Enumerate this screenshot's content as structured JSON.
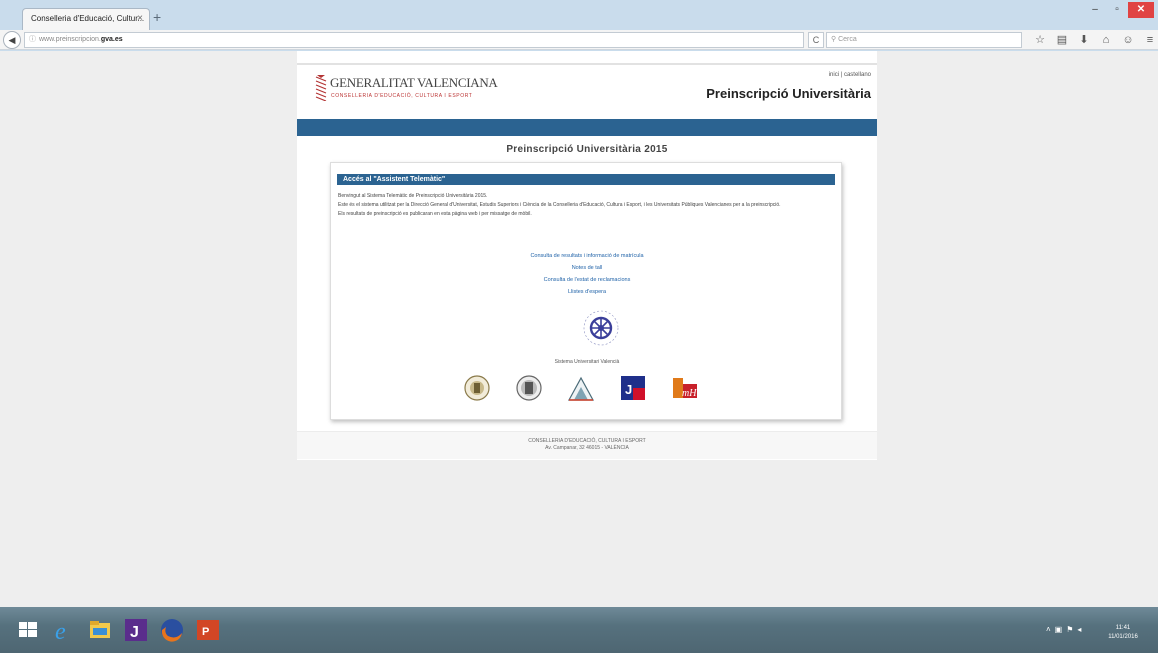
{
  "browser": {
    "tab_title": "Conselleria d'Educació, Cultur...",
    "tab_close": "×",
    "new_tab": "+",
    "window_buttons": {
      "minimize": "–",
      "maximize": "▫",
      "close": "✕"
    },
    "url_prefix": "www.preinscripcion.",
    "url_domain": "gva.es",
    "reload": "C",
    "search_placeholder": "Cerca",
    "toolbar_icons": [
      "star-icon",
      "reading-list-icon",
      "download-icon",
      "home-icon",
      "chat-icon",
      "menu-icon"
    ]
  },
  "header": {
    "logo_name": "GENERALITAT VALENCIANA",
    "logo_sub": "CONSELLERIA D'EDUCACIÓ, CULTURA I ESPORT",
    "lang_val": "inici",
    "lang_sep": "|",
    "lang_es": "castellano",
    "site_title": "Preinscripció Universitària"
  },
  "main": {
    "title": "Preinscripció Universitària 2015",
    "panel_heading": "Accés al \"Assistent Telemàtic\"",
    "paragraphs": [
      "Benvingut al Sistema Telemàtic de Preinscripció Universitària 2015.",
      "Este és el sistema utilitzat per la Direcció General d'Universitat, Estudis Superiors i Ciència de la Conselleria d'Educació, Cultura i Esport, i les Universitats Públiques Valencianes per a la preinscripció.",
      "Els resultats de preinscripció es publicaran en esta pàgina web i per missatge de mòbil."
    ],
    "links": [
      "Consulta de resultats i informació de matrícula",
      "Notes de tall",
      "Consulta de l'estat de reclamacions",
      "Llistes d'espera"
    ],
    "emblem_caption": "Sistema Universitari Valencià"
  },
  "footer": {
    "line1": "CONSELLERIA D'EDUCACIÓ, CULTURA I ESPORT",
    "line2": "Av. Campanar, 32 46015 - VALÈNCIA"
  },
  "taskbar": {
    "time": "11:41",
    "date": "11/01/2016"
  },
  "colors": {
    "brand_blue": "#2b6391",
    "link_blue": "#1f62a8",
    "gva_red": "#b33333"
  }
}
